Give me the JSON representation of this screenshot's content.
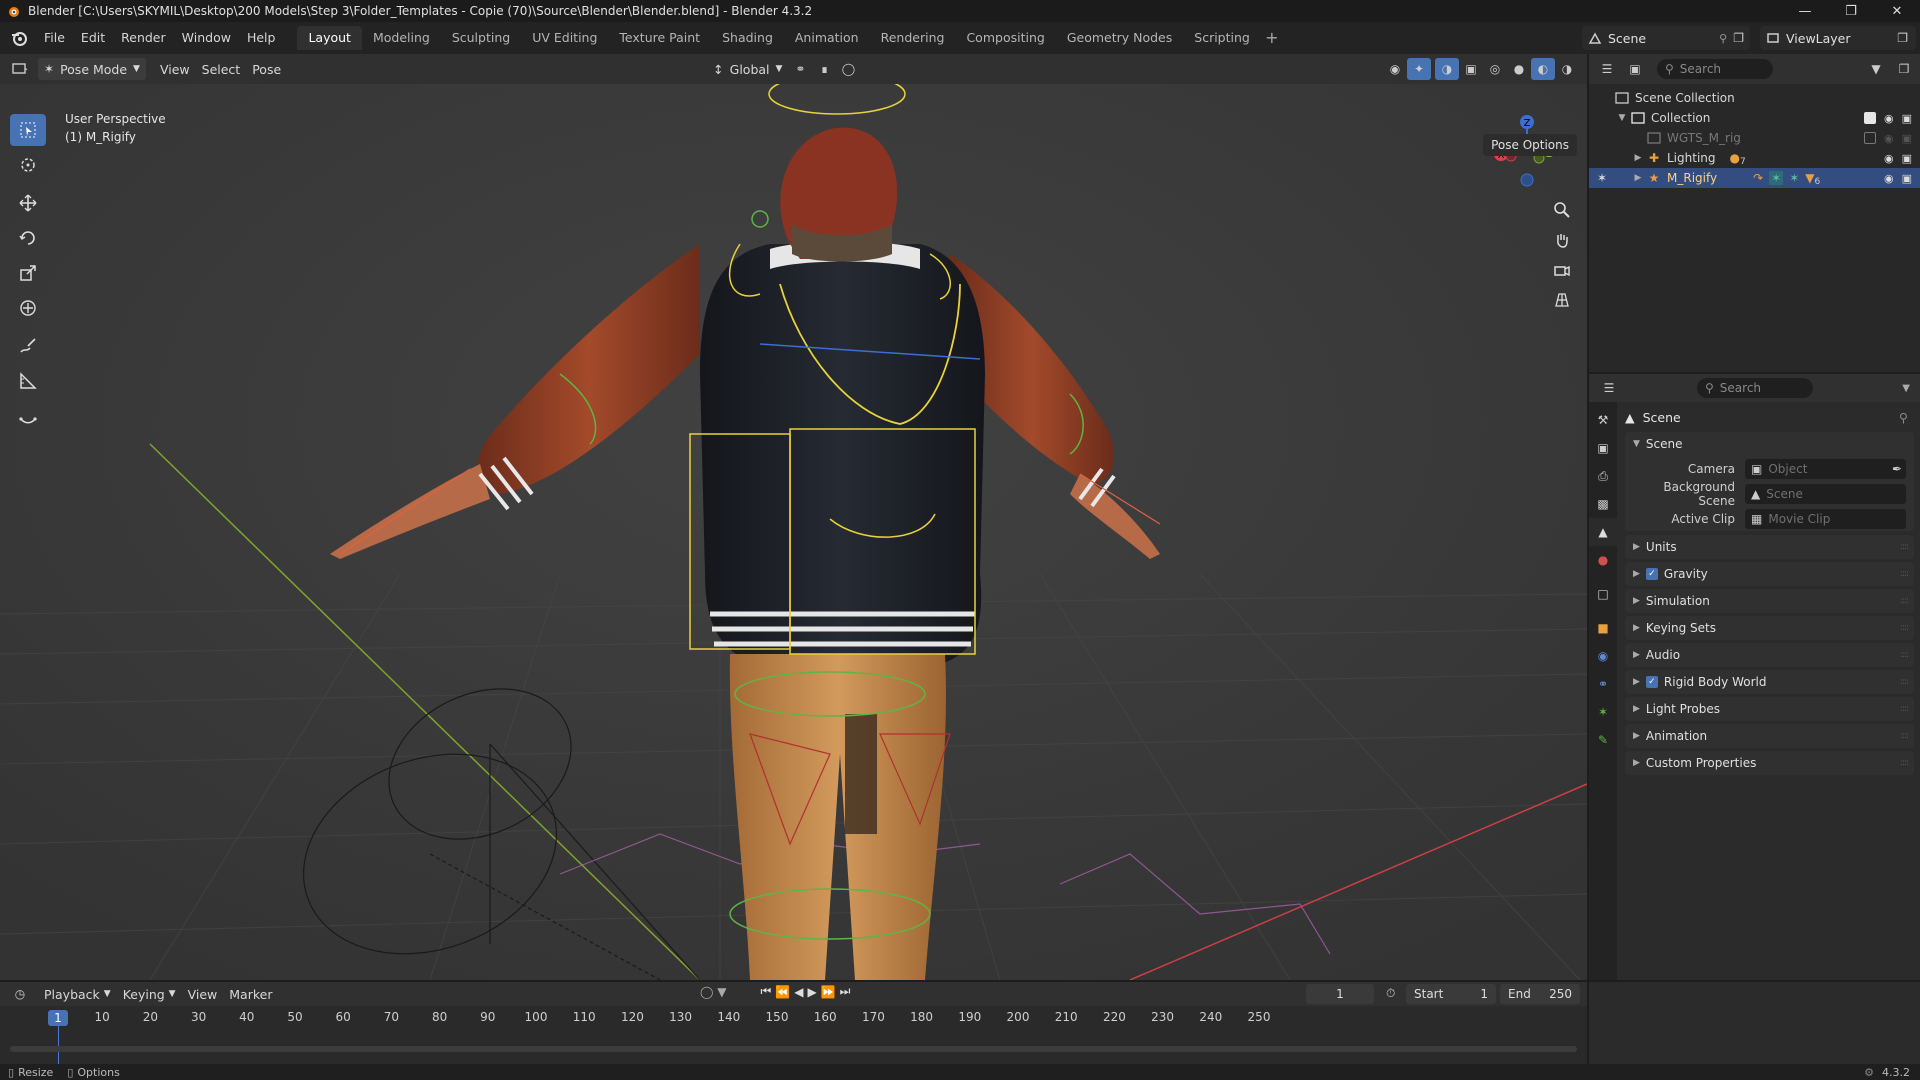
{
  "titlebar": {
    "title": "Blender [C:\\Users\\SKYMIL\\Desktop\\200 Models\\Step 3\\Folder_Templates - Copie (70)\\Source\\Blender\\Blender.blend] - Blender 4.3.2"
  },
  "menu": {
    "items": [
      "File",
      "Edit",
      "Render",
      "Window",
      "Help"
    ]
  },
  "workspaces": {
    "tabs": [
      "Layout",
      "Modeling",
      "Sculpting",
      "UV Editing",
      "Texture Paint",
      "Shading",
      "Animation",
      "Rendering",
      "Compositing",
      "Geometry Nodes",
      "Scripting"
    ],
    "active": "Layout"
  },
  "scene_selector": {
    "value": "Scene"
  },
  "viewlayer_selector": {
    "value": "ViewLayer"
  },
  "viewport": {
    "mode": "Pose Mode",
    "menus": [
      "View",
      "Select",
      "Pose"
    ],
    "transform_orientation": "Global",
    "info_line1": "User Perspective",
    "info_line2": "(1) M_Rigify",
    "pose_options": "Pose Options",
    "gizmo_axes": {
      "z": "Z",
      "y": "Y",
      "x": "X"
    },
    "colors": {
      "bg": "#3b3b3b",
      "x_axis": "#c8404a",
      "y_axis": "#7fa42e",
      "z_axis": "#3b6fd4",
      "bone_yellow": "#e8d23a",
      "active_blue": "#4772b3"
    }
  },
  "outliner": {
    "search_placeholder": "Search",
    "rows": [
      {
        "label": "Scene Collection",
        "indent": 0
      },
      {
        "label": "Collection",
        "indent": 1
      },
      {
        "label": "WGTS_M_rig",
        "indent": 2
      },
      {
        "label": "Lighting",
        "indent": 2,
        "badge": "7"
      },
      {
        "label": "M_Rigify",
        "indent": 2,
        "badge": "6"
      }
    ]
  },
  "properties": {
    "search_placeholder": "Search",
    "breadcrumb": "Scene",
    "scene_panel": {
      "title": "Scene",
      "camera_label": "Camera",
      "camera_placeholder": "Object",
      "bg_scene_label": "Background Scene",
      "bg_scene_placeholder": "Scene",
      "active_clip_label": "Active Clip",
      "active_clip_placeholder": "Movie Clip"
    },
    "panels": [
      "Units",
      "Gravity",
      "Simulation",
      "Keying Sets",
      "Audio",
      "Rigid Body World",
      "Light Probes",
      "Animation",
      "Custom Properties"
    ],
    "checked_panels": [
      "Gravity",
      "Rigid Body World"
    ]
  },
  "timeline": {
    "menus": [
      "Playback",
      "Keying",
      "View",
      "Marker"
    ],
    "current_frame": "1",
    "start_label": "Start",
    "start": "1",
    "end_label": "End",
    "end": "250",
    "ticks": [
      "10",
      "20",
      "30",
      "40",
      "50",
      "60",
      "70",
      "80",
      "90",
      "100",
      "110",
      "120",
      "130",
      "140",
      "150",
      "160",
      "170",
      "180",
      "190",
      "200",
      "210",
      "220",
      "230",
      "240",
      "250"
    ]
  },
  "statusbar": {
    "left1": "Resize",
    "left2": "Options",
    "version": "4.3.2"
  }
}
